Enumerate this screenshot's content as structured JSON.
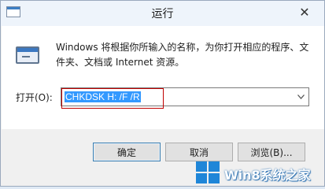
{
  "window": {
    "title": "运行",
    "close_glyph": "✕"
  },
  "body": {
    "description": "Windows 将根据你所输入的名称，为你打开相应的程序、文件夹、文档或 Internet 资源。",
    "open_label": "打开(O):",
    "open_value": "CHKDSK H: /F /R",
    "dropdown_icon": "chevron-down-icon"
  },
  "buttons": {
    "ok": "确定",
    "cancel": "取消",
    "browse": "浏览(B)..."
  },
  "watermark": {
    "text": "Win8系统之家"
  },
  "colors": {
    "selection": "#3399ff",
    "highlight_border": "#c00000",
    "accent": "#1f86d8"
  }
}
